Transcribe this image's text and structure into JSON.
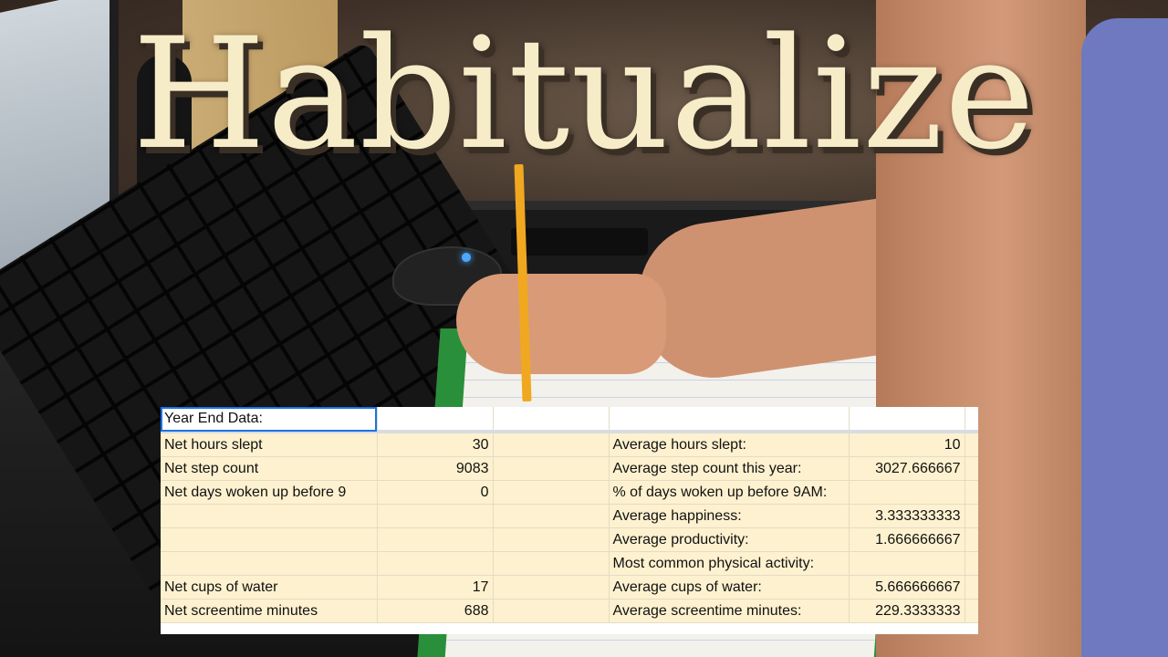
{
  "title": "Habitualize",
  "spreadsheet": {
    "header_cell": "Year End Data:",
    "rows": [
      {
        "label": "Net hours slept",
        "value": "30",
        "avg_label": "Average hours slept:",
        "avg_value": "10"
      },
      {
        "label": "Net step count",
        "value": "9083",
        "avg_label": "Average step count this year:",
        "avg_value": "3027.666667"
      },
      {
        "label": "Net days woken up before 9",
        "value": "0",
        "avg_label": "% of days woken up before 9AM:",
        "avg_value": ""
      },
      {
        "label": "",
        "value": "",
        "avg_label": "Average happiness:",
        "avg_value": "3.333333333"
      },
      {
        "label": "",
        "value": "",
        "avg_label": "Average productivity:",
        "avg_value": "1.666666667"
      },
      {
        "label": "",
        "value": "",
        "avg_label": "Most common physical activity:",
        "avg_value": ""
      },
      {
        "label": "Net cups of water",
        "value": "17",
        "avg_label": "Average cups of water:",
        "avg_value": "5.666666667"
      },
      {
        "label": "Net screentime minutes",
        "value": "688",
        "avg_label": "Average screentime minutes:",
        "avg_value": "229.3333333"
      }
    ]
  },
  "colors": {
    "row_fill": "#fdf1cf",
    "selection": "#1a73e8",
    "title_text": "#f7ecc8"
  }
}
